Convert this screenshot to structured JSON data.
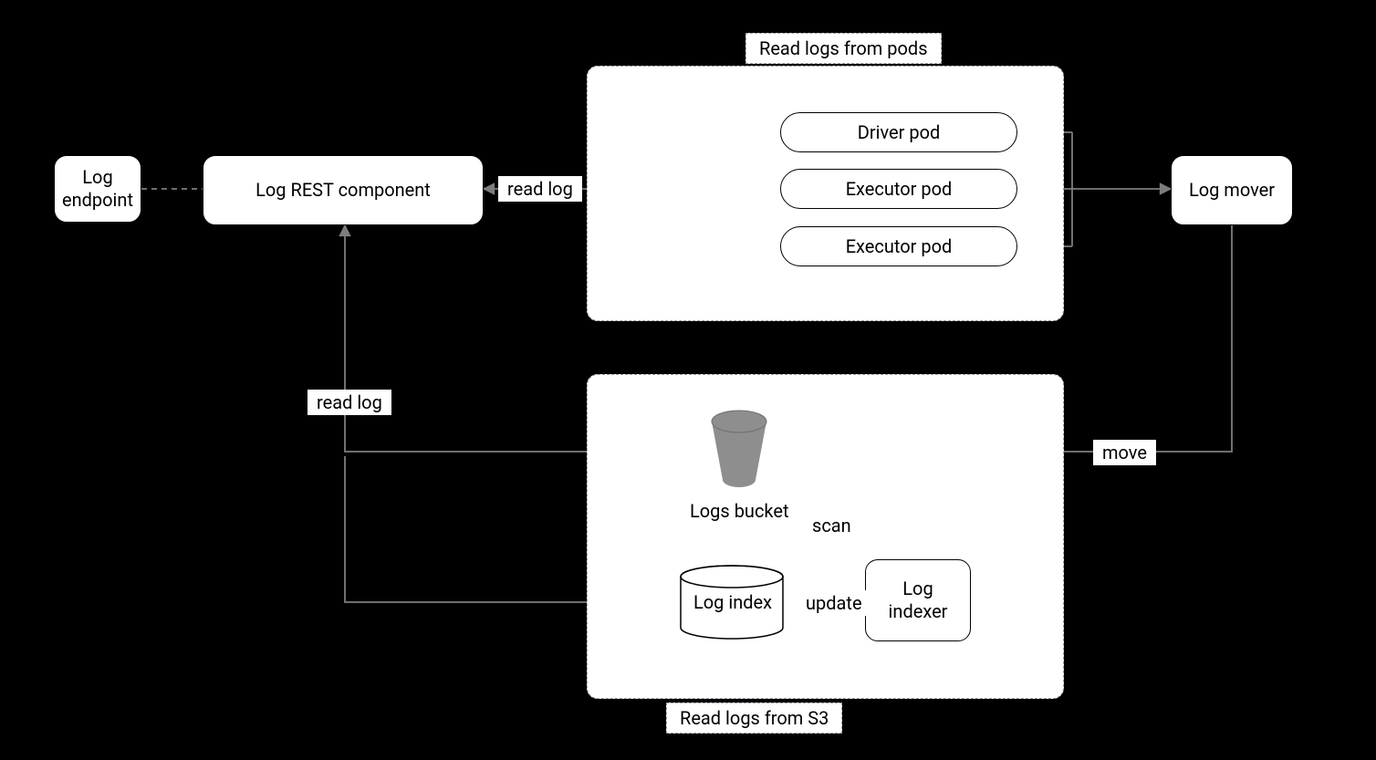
{
  "nodes": {
    "log_endpoint": "Log\nendpoint",
    "log_rest": "Log REST component",
    "log_mover": "Log mover",
    "driver_pod": "Driver pod",
    "executor_pod_1": "Executor pod",
    "executor_pod_2": "Executor pod",
    "logs_bucket": "Logs bucket",
    "log_index": "Log index",
    "log_indexer": "Log\nindexer"
  },
  "groups": {
    "pods_title": "Read logs from pods",
    "s3_title": "Read logs from S3"
  },
  "edges": {
    "read_log_top": "read log",
    "read_log_left": "read log",
    "move": "move",
    "scan": "scan",
    "update": "update"
  }
}
